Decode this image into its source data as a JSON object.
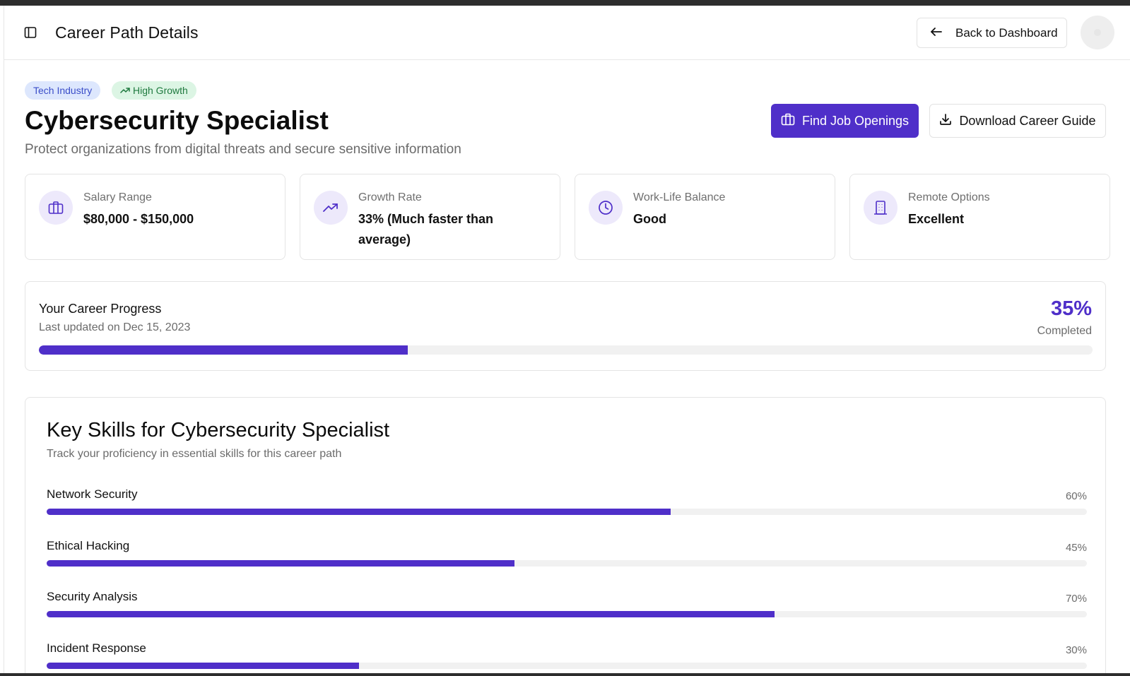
{
  "header": {
    "title": "Career Path Details",
    "back_label": "Back to Dashboard"
  },
  "badges": {
    "industry": "Tech Industry",
    "growth": "High Growth"
  },
  "career": {
    "title": "Cybersecurity Specialist",
    "description": "Protect organizations from digital threats and secure sensitive information",
    "find_jobs_label": "Find Job Openings",
    "download_label": "Download Career Guide"
  },
  "stats": [
    {
      "label": "Salary Range",
      "value": "$80,000 - $150,000",
      "icon": "briefcase-icon"
    },
    {
      "label": "Growth Rate",
      "value": "33% (Much faster than average)",
      "icon": "trending-up-icon"
    },
    {
      "label": "Work-Life Balance",
      "value": "Good",
      "icon": "clock-icon"
    },
    {
      "label": "Remote Options",
      "value": "Excellent",
      "icon": "building-icon"
    }
  ],
  "progress": {
    "title": "Your Career Progress",
    "updated": "Last updated on Dec 15, 2023",
    "percent_label": "35%",
    "percent": 35,
    "completed_label": "Completed"
  },
  "skills": {
    "title": "Key Skills for Cybersecurity Specialist",
    "subtitle": "Track your proficiency in essential skills for this career path",
    "items": [
      {
        "name": "Network Security",
        "percent_label": "60%",
        "percent": 60
      },
      {
        "name": "Ethical Hacking",
        "percent_label": "45%",
        "percent": 45
      },
      {
        "name": "Security Analysis",
        "percent_label": "70%",
        "percent": 70
      },
      {
        "name": "Incident Response",
        "percent_label": "30%",
        "percent": 30
      }
    ]
  },
  "colors": {
    "accent": "#4f2fc9",
    "track": "#f1f1f1",
    "icon_bg": "#ede9fb"
  }
}
